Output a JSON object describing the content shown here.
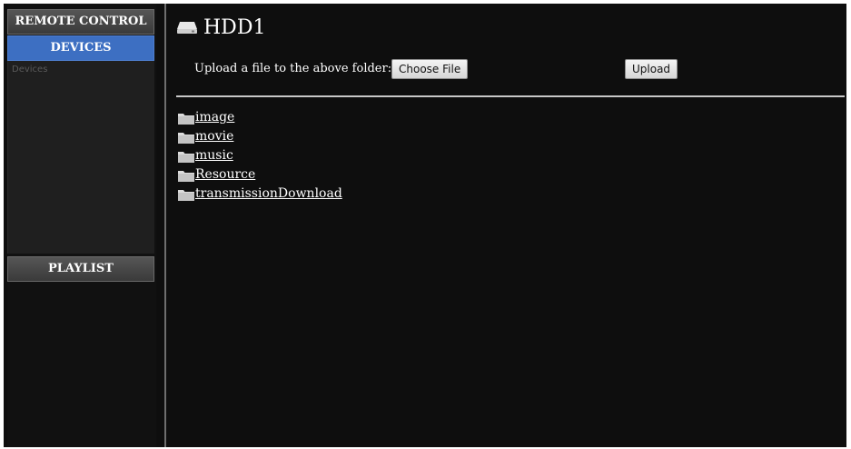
{
  "sidebar": {
    "remote_control": "REMOTE CONTROL",
    "devices": "DEVICES",
    "devices_link": "Devices",
    "playlist": "PLAYLIST"
  },
  "main": {
    "title": "HDD1",
    "title_icon": "hard-drive-icon",
    "upload_label": "Upload a file to the above folder:",
    "choose_file_label": "Choose File",
    "upload_button_label": "Upload"
  },
  "folders": [
    {
      "name": "image",
      "icon": "folder-icon"
    },
    {
      "name": "movie",
      "icon": "folder-icon"
    },
    {
      "name": "music",
      "icon": "folder-icon"
    },
    {
      "name": "Resource",
      "icon": "folder-icon"
    },
    {
      "name": "transmissionDownload",
      "icon": "folder-icon"
    }
  ],
  "colors": {
    "background": "#0e0e0e",
    "active_tab": "#3d6fc2",
    "header_gray": "#4a4a4a",
    "text": "#ffffff"
  }
}
